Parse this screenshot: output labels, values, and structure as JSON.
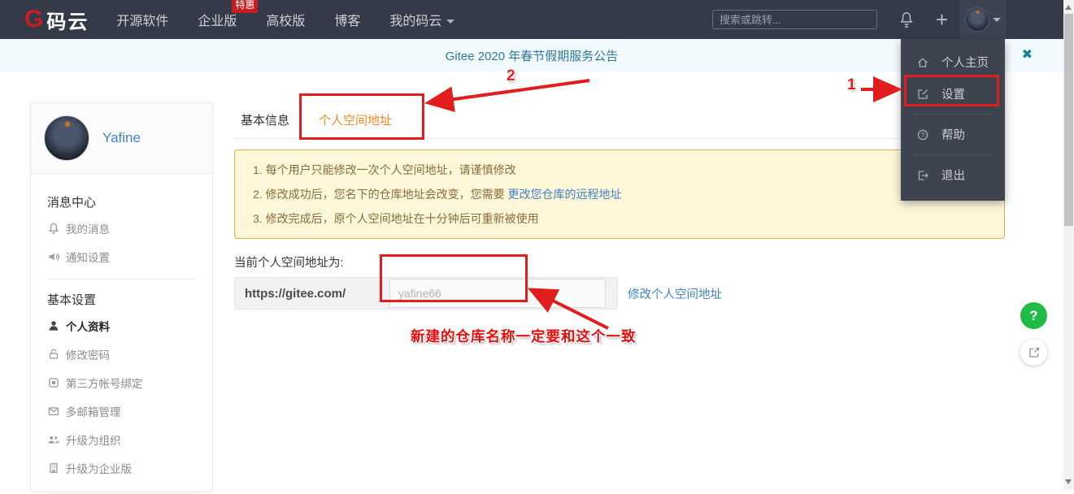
{
  "navbar": {
    "logo_g": "G",
    "logo_text": "码云",
    "menu": [
      {
        "label": "开源软件"
      },
      {
        "label": "企业版",
        "badge": "特惠"
      },
      {
        "label": "高校版"
      },
      {
        "label": "博客"
      },
      {
        "label": "我的码云"
      }
    ],
    "search_placeholder": "搜索或跳转..."
  },
  "banner": {
    "text": "Gitee 2020 年春节假期服务公告",
    "close_icon": "✖"
  },
  "user_menu": {
    "items": [
      {
        "icon": "home-icon",
        "label": "个人主页"
      },
      {
        "icon": "edit-icon",
        "label": "设置"
      },
      {
        "icon": "help-icon",
        "label": "帮助"
      },
      {
        "icon": "logout-icon",
        "label": "退出"
      }
    ]
  },
  "sidebar": {
    "username": "Yafine",
    "sections": [
      {
        "header": "消息中心",
        "items": [
          {
            "icon": "bell-icon",
            "label": "我的消息"
          },
          {
            "icon": "speaker-icon",
            "label": "通知设置"
          }
        ]
      },
      {
        "header": "基本设置",
        "items": [
          {
            "icon": "user-icon",
            "label": "个人资料",
            "active": true
          },
          {
            "icon": "lock-icon",
            "label": "修改密码"
          },
          {
            "icon": "id-card-icon",
            "label": "第三方帐号绑定"
          },
          {
            "icon": "mail-icon",
            "label": "多邮箱管理"
          },
          {
            "icon": "users-icon",
            "label": "升级为组织"
          },
          {
            "icon": "building-icon",
            "label": "升级为企业版"
          }
        ]
      }
    ]
  },
  "main": {
    "tabs": [
      {
        "label": "基本信息"
      },
      {
        "label": "个人空间地址",
        "active": true
      }
    ],
    "warning": {
      "line1": "1. 每个用户只能修改一次个人空间地址，请谨慎修改",
      "line2_prefix": "2. 修改成功后，您名下的仓库地址会改变，您需要 ",
      "line2_link": "更改您仓库的远程地址",
      "line3": "3. 修改完成后，原个人空间地址在十分钟后可重新被使用"
    },
    "current_label": "当前个人空间地址为:",
    "url_prefix": "https://gitee.com/",
    "input_placeholder": "yafine66",
    "modify_link": "修改个人空间地址"
  },
  "annotations": {
    "step1": "1",
    "step2": "2",
    "note": "新建的仓库名称一定要和这个一致"
  },
  "floating": {
    "help_label": "?"
  },
  "colors": {
    "brand_red": "#c71d23",
    "navbar_bg": "#343a47",
    "dropdown_bg": "#3d434f",
    "banner_bg": "#f3fafd",
    "banner_text": "#2b7a9b",
    "warning_bg": "#fdf6d8",
    "warning_border": "#dfae4f",
    "warning_text": "#8a6d3b",
    "link_blue": "#4183c4",
    "active_tab_orange": "#f08a24",
    "annotation_red": "#e11d1d",
    "help_green": "#21ba45"
  }
}
